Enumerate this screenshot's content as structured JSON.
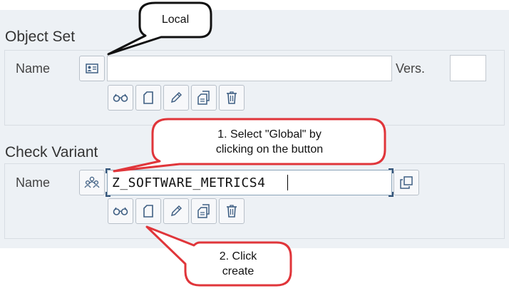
{
  "object_set": {
    "title": "Object Set",
    "name_label": "Name",
    "name_value": "",
    "version_label": "Vers.",
    "version_value": "",
    "toolbar": [
      "display-icon",
      "create-icon",
      "edit-icon",
      "copy-icon",
      "delete-icon"
    ]
  },
  "check_variant": {
    "title": "Check Variant",
    "name_label": "Name",
    "name_value": "Z_SOFTWARE_METRICS4",
    "toolbar": [
      "display-icon",
      "create-icon",
      "edit-icon",
      "copy-icon",
      "delete-icon"
    ]
  },
  "callouts": {
    "local": "Local",
    "select_global_line1": "1. Select \"Global\" by",
    "select_global_line2": "clicking on the button",
    "click_create_line1": "2. Click",
    "click_create_line2": "create"
  },
  "colors": {
    "panel_bg": "#edf1f5",
    "callout_red": "#e0353a",
    "icon_blue": "#3f5f83"
  }
}
